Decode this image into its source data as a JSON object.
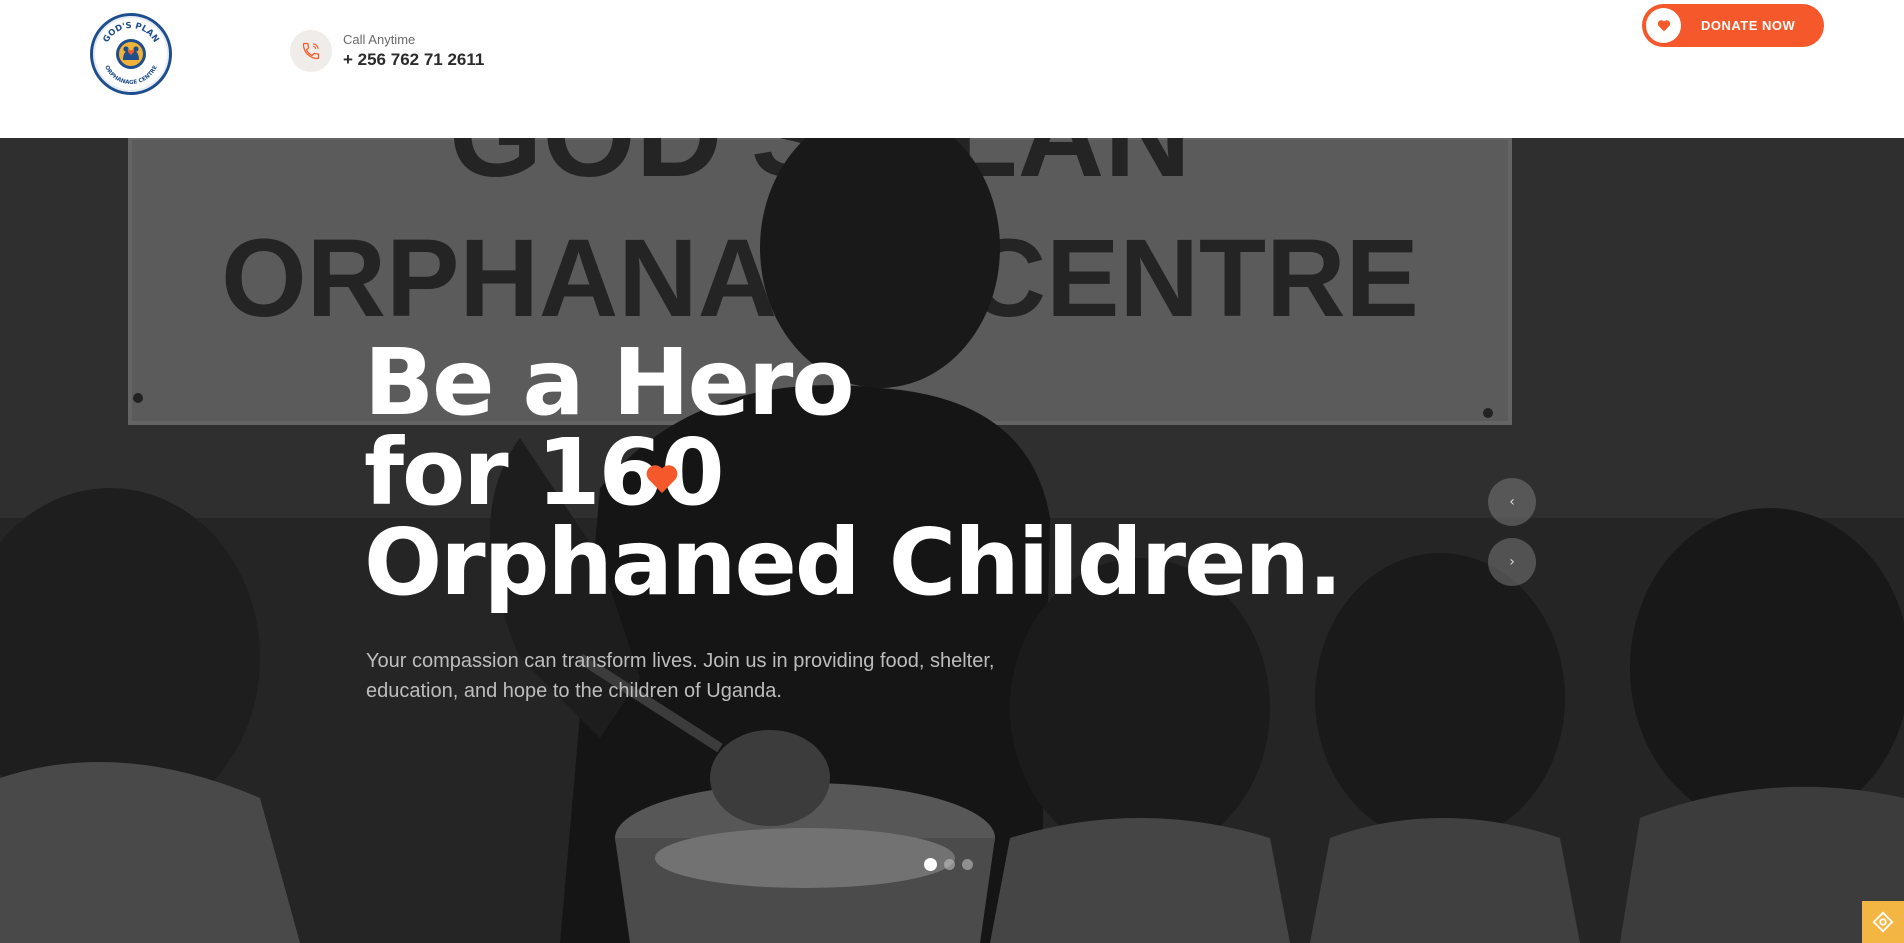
{
  "brand": {
    "logo_alt": "God's Plan Orphanage Centre logo",
    "logo_top_text": "GOD'S PLAN",
    "logo_bottom_text": "ORPHANAGE CENTRE",
    "primary_color": "#f5582a",
    "navy_color": "#1f4e8c"
  },
  "contact": {
    "label": "Call Anytime",
    "phone": "+ 256 762 71 2611",
    "icon": "phone-icon"
  },
  "header": {
    "donate_label": "DONATE NOW",
    "donate_icon": "heart-icon"
  },
  "hero": {
    "title_line1": "Be a Hero",
    "title_line2": "for 160",
    "title_line3": "Orphaned Children.",
    "subtitle": "Your compassion can transform lives. Join us in providing food, shelter, education, and hope to the children of Uganda.",
    "background_sign_line1": "GOD'S PLAN",
    "background_sign_line2": "ORPHANAGE CENTRE",
    "prev_glyph": "‹",
    "next_glyph": "›",
    "slides_total": 3,
    "active_slide": 1
  },
  "widget": {
    "icon": "accessibility-icon",
    "color": "#f3b643"
  }
}
